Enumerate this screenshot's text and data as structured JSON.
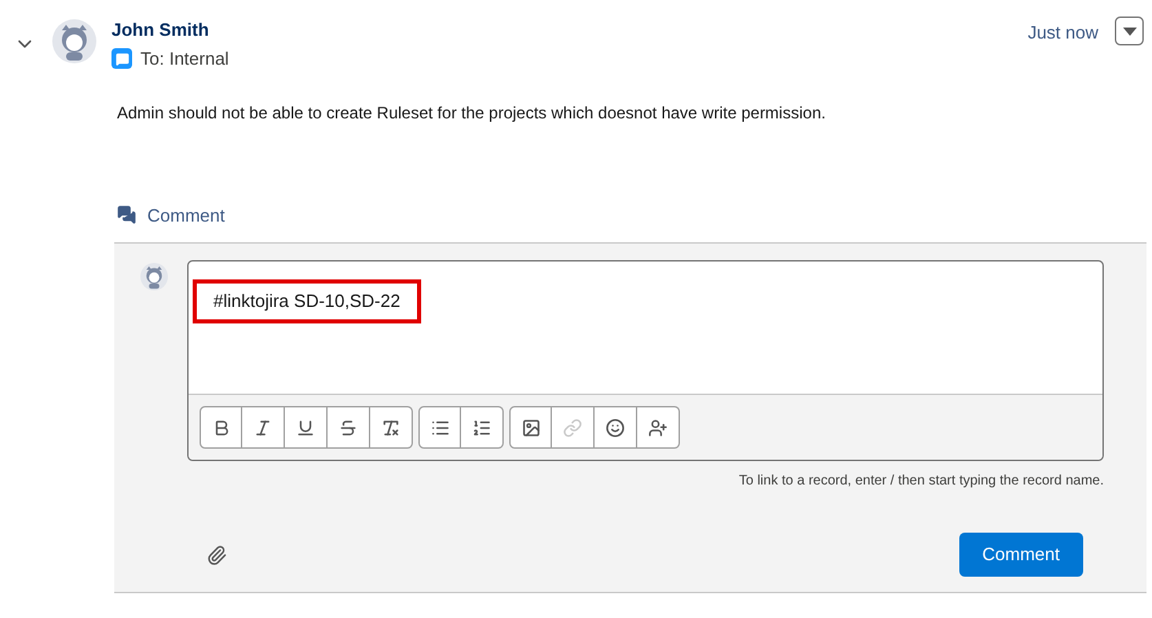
{
  "post": {
    "author": "John Smith",
    "audience": "To: Internal",
    "time": "Just now",
    "body": "Admin should not be able to create Ruleset for the projects which doesnot have write permission.",
    "expanded": true
  },
  "comment_action": {
    "label": "Comment"
  },
  "composer": {
    "value": "#linktojira SD-10,SD-22",
    "highlighted": true,
    "toolbar": [
      [
        {
          "kind": "bold",
          "disabled": false
        },
        {
          "kind": "italic",
          "disabled": false
        },
        {
          "kind": "underline",
          "disabled": false
        },
        {
          "kind": "strikethrough",
          "disabled": false
        },
        {
          "kind": "clear",
          "disabled": false
        }
      ],
      [
        {
          "kind": "bullets",
          "disabled": false
        },
        {
          "kind": "numbers",
          "disabled": false
        }
      ],
      [
        {
          "kind": "image",
          "disabled": false
        },
        {
          "kind": "link",
          "disabled": true
        },
        {
          "kind": "emoji",
          "disabled": false
        },
        {
          "kind": "mention",
          "disabled": false
        }
      ]
    ],
    "hint": "To link to a record, enter / then start typing the record name.",
    "submit": "Comment"
  }
}
